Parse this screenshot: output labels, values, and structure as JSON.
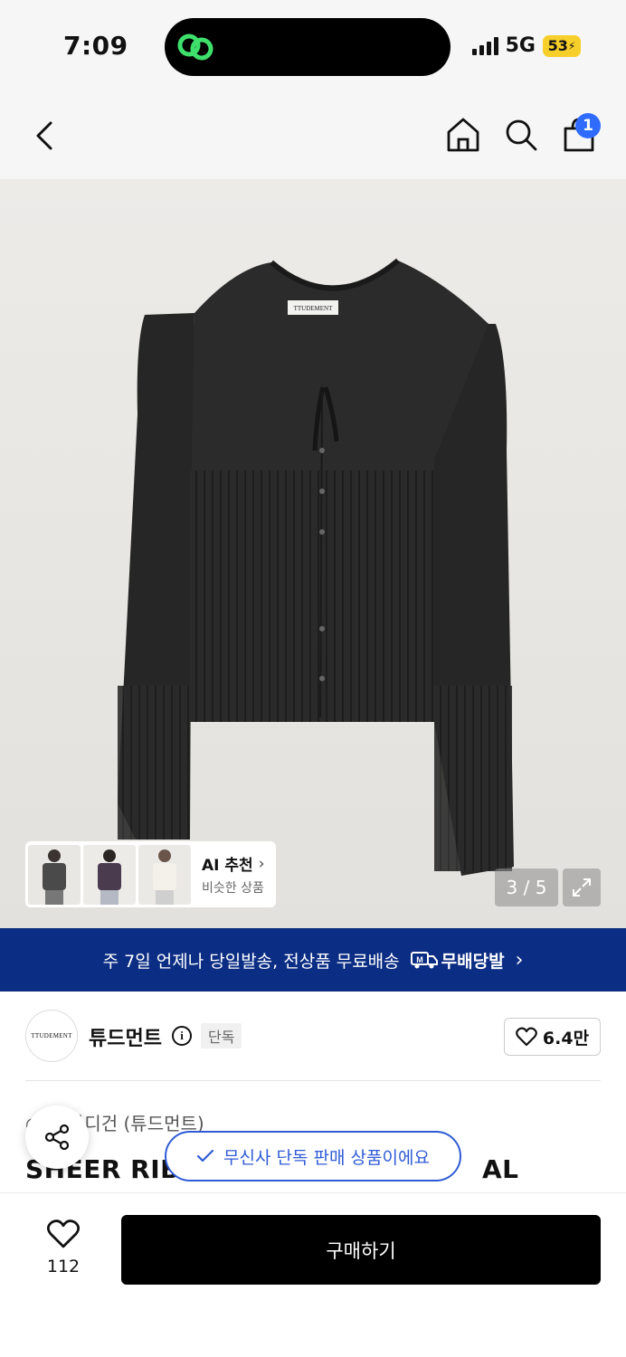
{
  "status_bar": {
    "time": "7:09",
    "network": "5G",
    "battery": "53"
  },
  "nav": {
    "cart_count": "1"
  },
  "gallery": {
    "counter": "3 / 5",
    "garment_label": "TTUDEMENT",
    "ai_card": {
      "title": "AI 추천",
      "subtitle": "비슷한 상품"
    }
  },
  "banner": {
    "text": "주 7일 언제나 당일발송, 전상품 무료배송",
    "badge": "무배당발"
  },
  "brand": {
    "logo_text": "TTUDEMENT",
    "name": "튜드먼트",
    "tag": "단독",
    "likes": "6.4만"
  },
  "product": {
    "breadcrumb_visible": "> 카디건 (튜드먼트)",
    "title_left": "SHEER RIB",
    "title_right": "AL"
  },
  "toast": {
    "text": "무신사 단독 판매 상품이에요"
  },
  "bottom": {
    "wish_count": "112",
    "buy_label": "구매하기"
  },
  "colors": {
    "banner": "#0b2d83",
    "accent": "#2f5bd6",
    "badge": "#2f6bff",
    "buy": "#000000"
  }
}
